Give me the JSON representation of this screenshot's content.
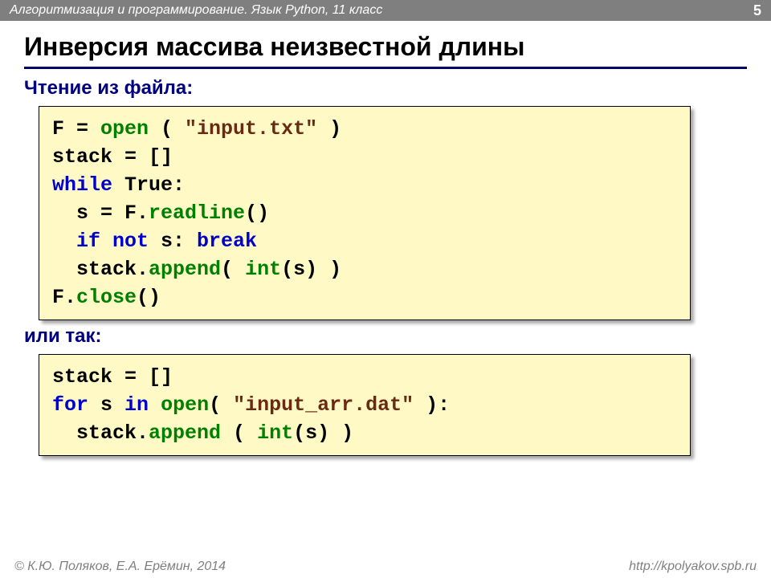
{
  "header": {
    "left": "Алгоритмизация и программирование. Язык Python, 11 класс",
    "page": "5"
  },
  "title": "Инверсия массива неизвестной длины",
  "sub1": "Чтение из файла:",
  "code1": {
    "l1a": "F = ",
    "l1b": "open",
    "l1c": " ( ",
    "l1d": "\"input.txt\"",
    "l1e": " )",
    "l2": "stack = []",
    "l3a": "while",
    "l3b": " True:",
    "l4a": "  s = F.",
    "l4b": "readline",
    "l4c": "()",
    "l5a": "  ",
    "l5b": "if not",
    "l5c": " s: ",
    "l5d": "break",
    "l6a": "  stack.",
    "l6b": "append",
    "l6c": "( ",
    "l6d": "int",
    "l6e": "(s) )",
    "l7a": "F.",
    "l7b": "close",
    "l7c": "()"
  },
  "sub2": "или так:",
  "code2": {
    "l1": "stack = []",
    "l2a": "for",
    "l2b": " s ",
    "l2c": "in",
    "l2d": " ",
    "l2e": "open",
    "l2f": "( ",
    "l2g": "\"input_arr.dat\"",
    "l2h": " ):",
    "l3a": "  stack.",
    "l3b": "append",
    "l3c": " ( ",
    "l3d": "int",
    "l3e": "(s) )"
  },
  "footer": {
    "left": "© К.Ю. Поляков, Е.А. Ерёмин, 2014",
    "right": "http://kpolyakov.spb.ru"
  }
}
